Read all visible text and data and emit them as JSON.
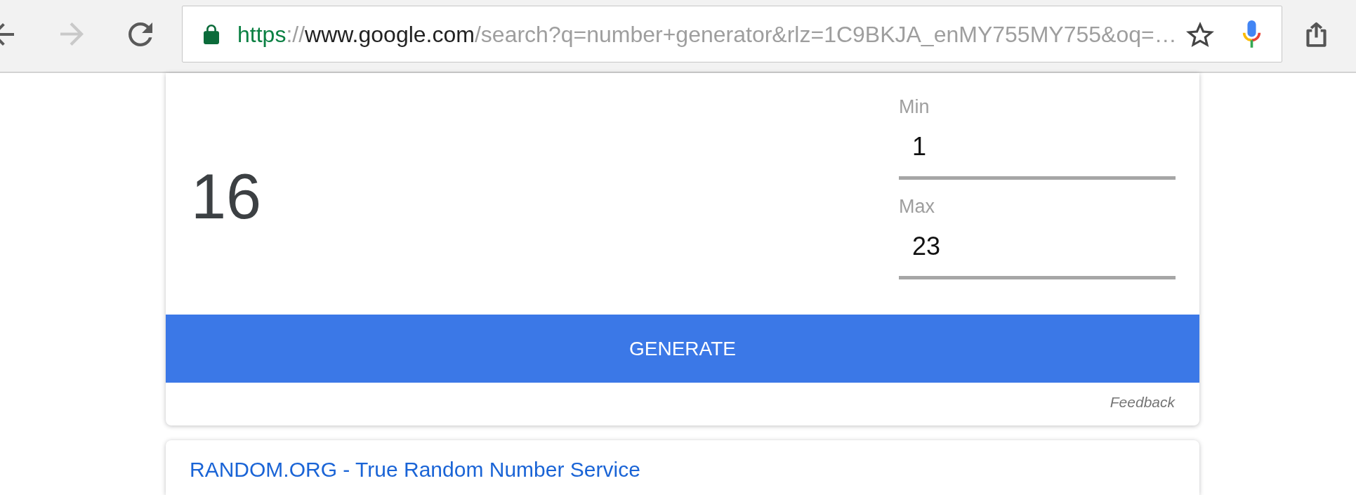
{
  "toolbar": {
    "nav_buttons": [
      {
        "kind": "back",
        "disabled": false
      },
      {
        "kind": "forward",
        "disabled": true
      },
      {
        "kind": "reload",
        "disabled": false
      }
    ],
    "address_bar": {
      "url": {
        "scheme": "https",
        "separator": "://",
        "host": "www.google.com",
        "path": "/search?q=number+generator&rlz=1C9BKJA_enMY755MY755&oq=…"
      },
      "starred": false
    }
  },
  "generator": {
    "result": "16",
    "fields": [
      {
        "label": "Min",
        "value": "1"
      },
      {
        "label": "Max",
        "value": "23"
      }
    ],
    "button": "GENERATE",
    "feedback": "Feedback"
  },
  "results": [
    {
      "title": "RANDOM.ORG - True Random Number Service"
    }
  ]
}
